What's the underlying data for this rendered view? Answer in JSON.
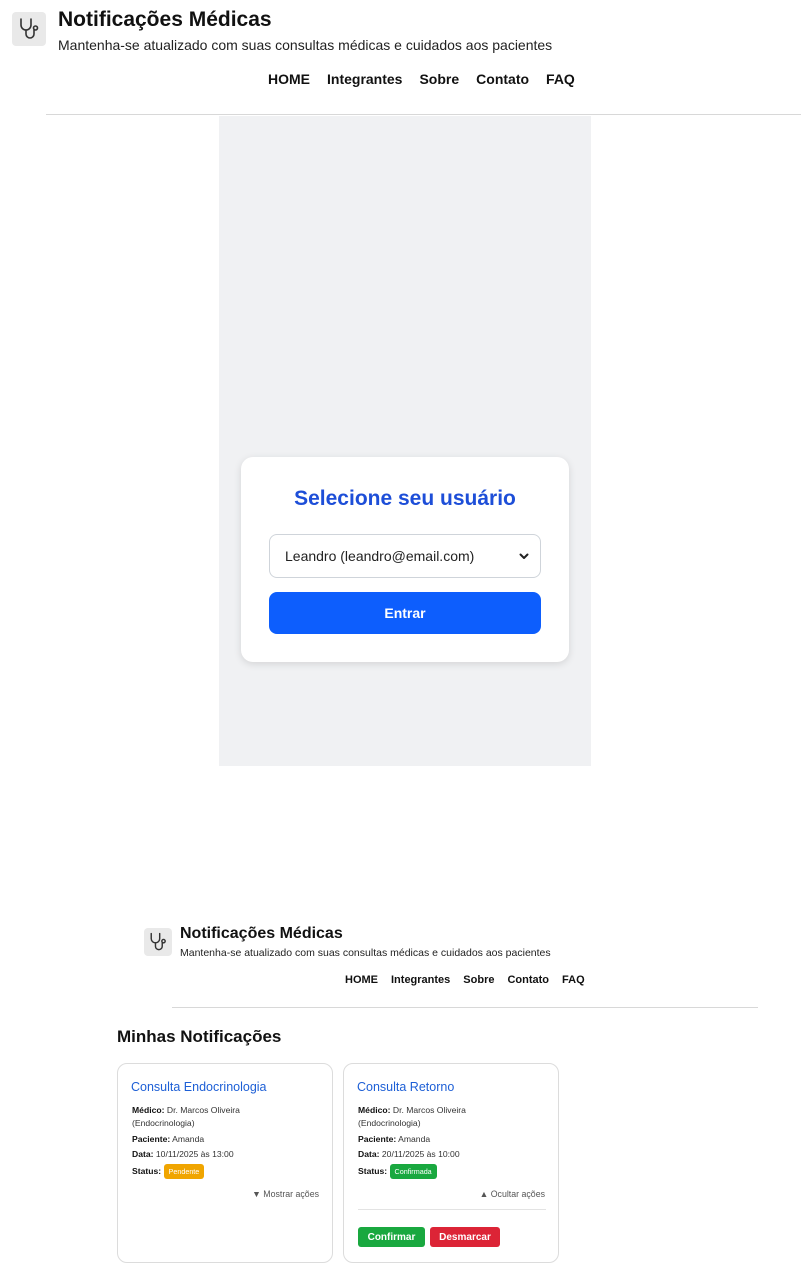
{
  "header": {
    "title": "Notificações Médicas",
    "subtitle": "Mantenha-se atualizado com suas consultas médicas e cuidados aos pacientes",
    "nav": [
      "HOME",
      "Integrantes",
      "Sobre",
      "Contato",
      "FAQ"
    ],
    "logo_icon": "stethoscope-icon"
  },
  "login": {
    "heading": "Selecione seu usuário",
    "selected_user": "Leandro (leandro@email.com)",
    "submit_label": "Entrar"
  },
  "notifications": {
    "section_title": "Minhas Notificações",
    "labels": {
      "doctor": "Médico:",
      "patient": "Paciente:",
      "date": "Data:",
      "status": "Status:"
    },
    "cards": [
      {
        "title": "Consulta Endocrinologia",
        "doctor_name": "Dr. Marcos Oliveira",
        "doctor_specialty": "(Endocrinologia)",
        "patient": "Amanda",
        "date": "10/11/2025 às 13:00",
        "status": "Pendente",
        "toggle_label": "▼ Mostrar ações"
      },
      {
        "title": "Consulta Retorno",
        "doctor_name": "Dr. Marcos Oliveira",
        "doctor_specialty": "(Endocrinologia)",
        "patient": "Amanda",
        "date": "20/11/2025 às 10:00",
        "status": "Confirmada",
        "toggle_label": "▲ Ocultar ações",
        "actions": {
          "confirm": "Confirmar",
          "cancel": "Desmarcar"
        }
      }
    ]
  },
  "colors": {
    "primary_button": "#0d5efd",
    "heading_blue": "#1d4ed8",
    "pending": "#f0a500",
    "confirmed": "#19a83f",
    "cancel": "#dc2436"
  }
}
